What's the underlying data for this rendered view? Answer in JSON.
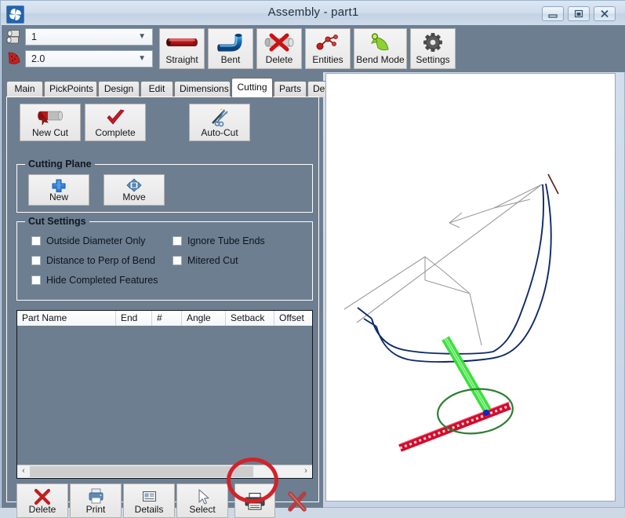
{
  "window": {
    "title": "Assembly - part1",
    "app_icon": "pinwheel-icon",
    "controls": {
      "minimize": "minimize-icon",
      "maximize": "maximize-icon",
      "close": "close-icon"
    }
  },
  "toolbar": {
    "quantity_combo": {
      "value": "1",
      "icon": "tube-icon",
      "chevron": "▼"
    },
    "diameter_combo": {
      "value": "2.0",
      "icon": "bend-segment-icon",
      "chevron": "▼"
    },
    "buttons": [
      {
        "label": "Straight",
        "icon": "straight-tube-icon"
      },
      {
        "label": "Bent",
        "icon": "bent-tube-icon"
      },
      {
        "label": "Delete",
        "icon": "delete-tube-icon"
      },
      {
        "label": "Entities",
        "icon": "entities-icon"
      },
      {
        "label": "Bend Mode",
        "icon": "bend-mode-icon"
      },
      {
        "label": "Settings",
        "icon": "gear-icon"
      }
    ]
  },
  "tabs": [
    {
      "label": "Main",
      "active": false
    },
    {
      "label": "PickPoints",
      "active": false
    },
    {
      "label": "Design",
      "active": false
    },
    {
      "label": "Edit",
      "active": false
    },
    {
      "label": "Dimensions",
      "active": false
    },
    {
      "label": "Cutting",
      "active": true
    },
    {
      "label": "Parts",
      "active": false
    },
    {
      "label": "Details",
      "active": false
    }
  ],
  "cutting_tab": {
    "top_buttons": [
      {
        "label": "New Cut",
        "icon": "new-cut-icon"
      },
      {
        "label": "Complete",
        "icon": "checkmark-icon"
      },
      {
        "label": "Auto-Cut",
        "icon": "scissors-wand-icon"
      }
    ],
    "cutting_plane": {
      "title": "Cutting Plane",
      "buttons": [
        {
          "label": "New",
          "icon": "plus-icon"
        },
        {
          "label": "Move",
          "icon": "move-arrows-icon"
        }
      ]
    },
    "cut_settings": {
      "title": "Cut Settings",
      "checkboxes": [
        {
          "label": "Outside Diameter Only",
          "checked": false
        },
        {
          "label": "Ignore Tube Ends",
          "checked": false
        },
        {
          "label": "Distance to Perp of Bend",
          "checked": false
        },
        {
          "label": "Mitered Cut",
          "checked": false
        },
        {
          "label": "Hide Completed Features",
          "checked": false
        }
      ]
    },
    "grid": {
      "columns": [
        "Part Name",
        "End",
        "#",
        "Angle",
        "Setback",
        "Offset"
      ],
      "rows": [],
      "scrollbar": {
        "left_arrow": "‹",
        "right_arrow": "›"
      }
    },
    "action_buttons": [
      {
        "label": "Delete",
        "icon": "red-x-icon"
      },
      {
        "label": "Print",
        "icon": "printer-small-icon"
      },
      {
        "label": "Details",
        "icon": "details-icon"
      },
      {
        "label": "Select",
        "icon": "cursor-arrow-icon"
      }
    ],
    "extra_buttons": [
      {
        "label": "",
        "icon": "printer-icon",
        "highlighted": true
      },
      {
        "label": "",
        "icon": "red-x-close-icon",
        "highlighted": false
      }
    ]
  },
  "annotation": {
    "type": "circle-highlight",
    "color": "#d2222a",
    "target": "printer-icon"
  },
  "viewport": {
    "name": "3d-model-viewport",
    "model": "tube-assembly-wireframe",
    "colors": {
      "construction_lines": "#9a9a9a",
      "tube_path": "#0d2a6b",
      "selected_tube": "#2bdd2b",
      "cut_tube": "#d20b2b",
      "highlight_ellipse": "#2e7d32",
      "background": "#ffffff"
    }
  },
  "theme": {
    "panel_bg": "#6d7e90",
    "titlebar_bg": "#cfdcec",
    "button_face": "#eeeeee",
    "accent_red": "#d2222a"
  }
}
